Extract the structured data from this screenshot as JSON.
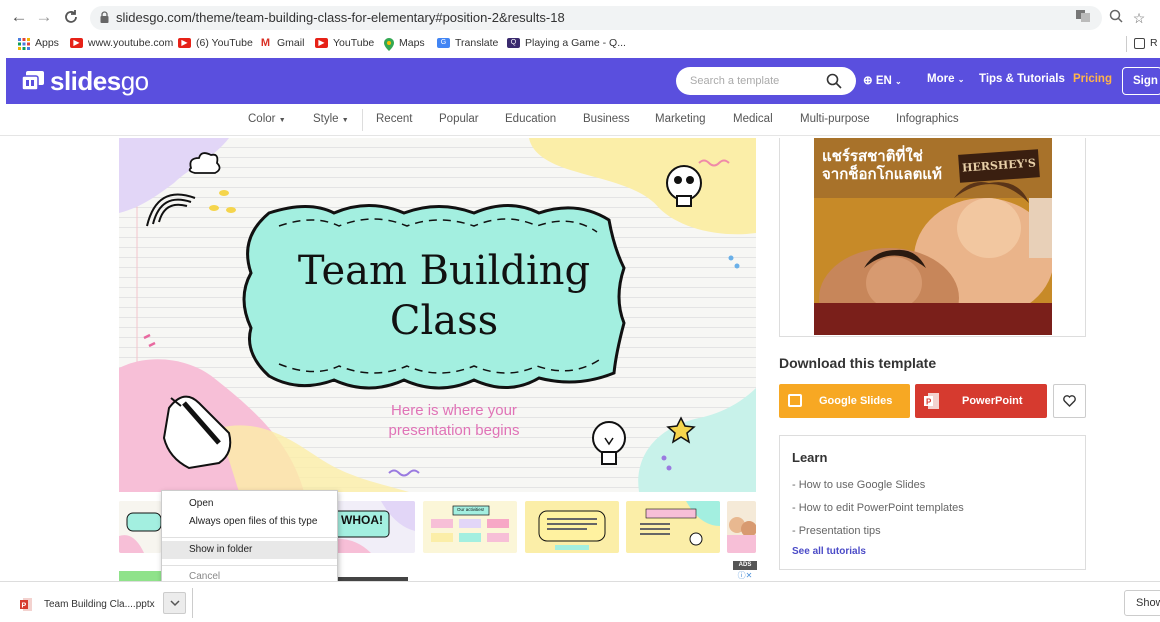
{
  "browser": {
    "url": "slidesgo.com/theme/team-building-class-for-elementary#position-2&results-18",
    "bookmarks": [
      {
        "label": "Apps",
        "icon": "apps-grid-icon"
      },
      {
        "label": "www.youtube.com",
        "icon": "youtube-icon"
      },
      {
        "label": "(6) YouTube",
        "icon": "youtube-icon"
      },
      {
        "label": "Gmail",
        "icon": "gmail-icon"
      },
      {
        "label": "YouTube",
        "icon": "youtube-icon"
      },
      {
        "label": "Maps",
        "icon": "maps-pin-icon"
      },
      {
        "label": "Translate",
        "icon": "translate-icon"
      },
      {
        "label": "Playing a Game - Q...",
        "icon": "quizlet-icon"
      }
    ],
    "reading_list_label": "R"
  },
  "header": {
    "logo_main": "slides",
    "logo_light": "go",
    "search_placeholder": "Search a template",
    "lang_label": "EN",
    "more_label": "More",
    "tips_label": "Tips & Tutorials",
    "pricing_label": "Pricing",
    "signin_label": "Sign"
  },
  "categories": [
    "Color",
    "Style",
    "Recent",
    "Popular",
    "Education",
    "Business",
    "Marketing",
    "Medical",
    "Multi-purpose",
    "Infographics"
  ],
  "preview": {
    "title_line1": "Team Building",
    "title_line2": "Class",
    "subtitle_line1": "Here is where your",
    "subtitle_line2": "presentation begins"
  },
  "thumbnails": {
    "thumb2_text": "WHOA!",
    "thumb3_text": "Our activities!"
  },
  "context_menu": {
    "items": [
      "Open",
      "Always open files of this type",
      "Show in folder",
      "Cancel"
    ]
  },
  "ad": {
    "text_line1": "แชร์รสชาติที่ใช่",
    "text_line2": "จากช็อกโกแลตแท้",
    "brand": "HERSHEY'S",
    "ads_badge": "ADS"
  },
  "download": {
    "title": "Download this template",
    "google_slides_label": "Google Slides",
    "powerpoint_label": "PowerPoint"
  },
  "learn": {
    "title": "Learn",
    "links": [
      "- How to use Google Slides",
      "- How to edit PowerPoint templates",
      "- Presentation tips"
    ],
    "see_all": "See all tutorials"
  },
  "download_bar": {
    "filename": "Team Building Cla....pptx",
    "show_all_label": "Show"
  },
  "colors": {
    "brand": "#5a4fde",
    "pricing": "#ffb44a",
    "google_slides": "#f7a823",
    "powerpoint": "#d63a2f",
    "mint": "#a3efe0"
  }
}
